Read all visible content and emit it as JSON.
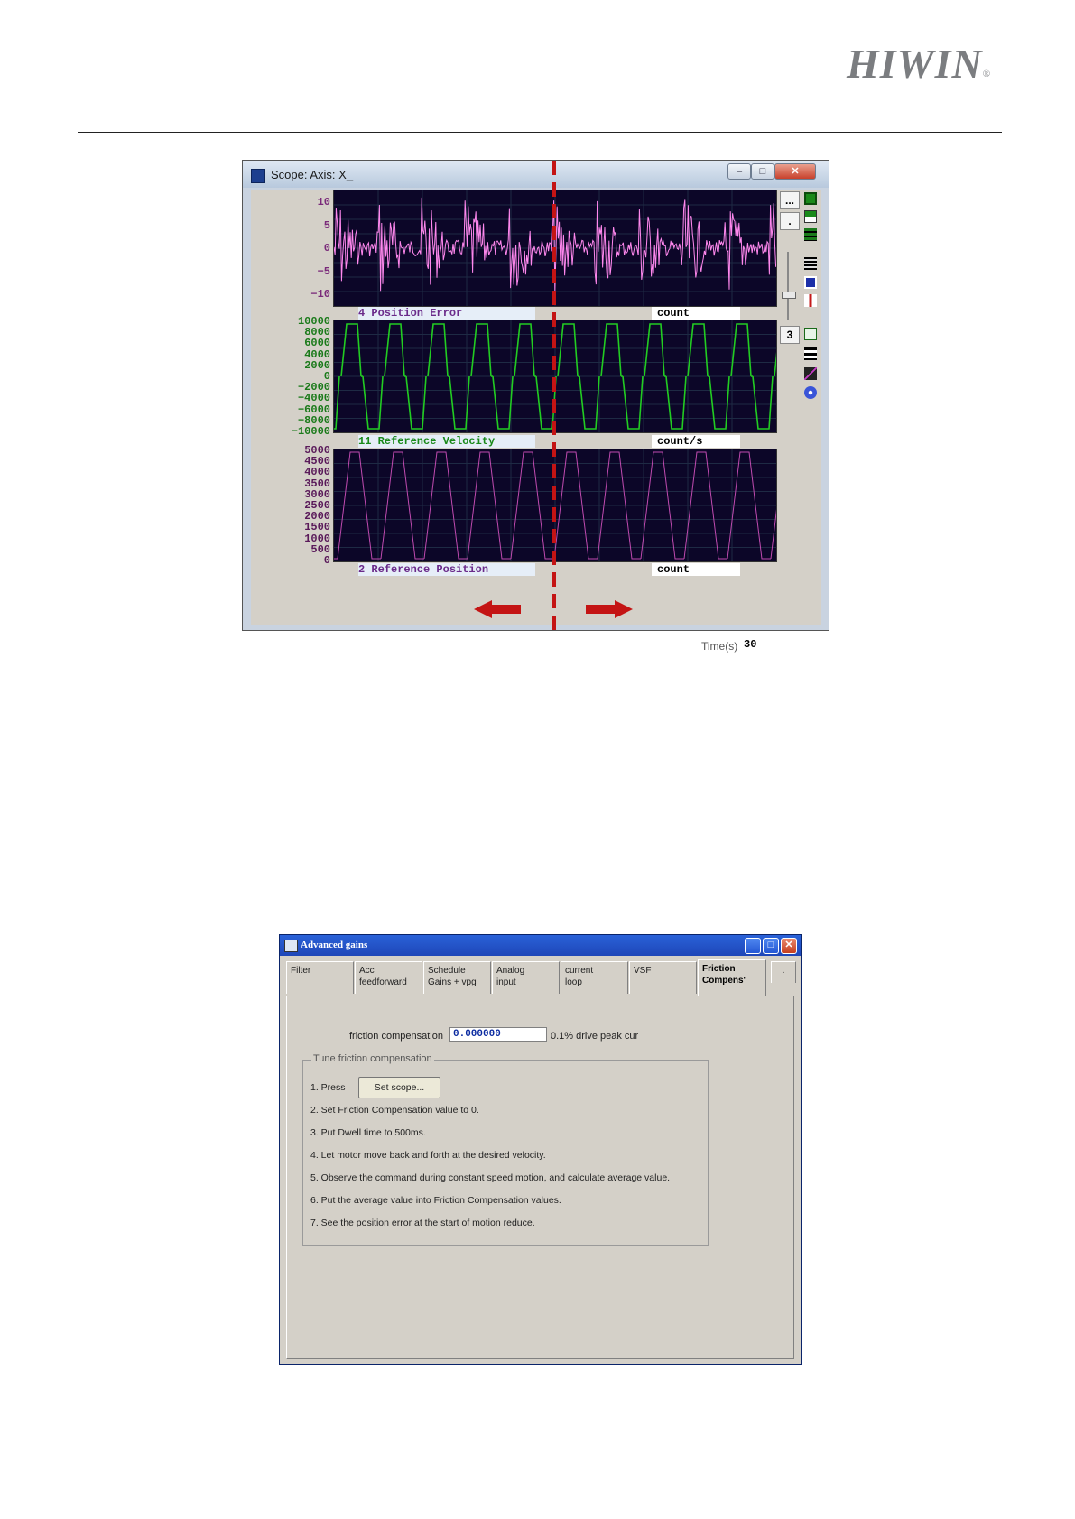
{
  "header": {
    "brand": "HIWIN",
    "brand_mark": "®"
  },
  "scope_window": {
    "title": "Scope: Axis: X_",
    "window_controls": {
      "minimize": "–",
      "maximize": "□",
      "close": "✕"
    },
    "side_buttons": {
      "more": "...",
      "dot": ".",
      "channel_number": "3"
    },
    "channels": [
      {
        "label": "4 Position Error",
        "unit": "count",
        "color": "#ff88ee",
        "y_ticks": [
          "10",
          "5",
          "0",
          "-5",
          "-10"
        ],
        "ylim": [
          -10,
          10
        ]
      },
      {
        "label": "11 Reference Velocity",
        "unit": "count/s",
        "color": "#22cc22",
        "y_ticks": [
          "10000",
          "8000",
          "6000",
          "4000",
          "2000",
          "0",
          "-2000",
          "-4000",
          "-6000",
          "-8000",
          "-10000"
        ],
        "ylim": [
          -10000,
          10000
        ]
      },
      {
        "label": "2 Reference Position",
        "unit": "count",
        "color": "#c04bb0",
        "y_ticks": [
          "5000",
          "4500",
          "4000",
          "3500",
          "3000",
          "2500",
          "2000",
          "1500",
          "1000",
          "500",
          "0"
        ],
        "ylim": [
          0,
          5000
        ]
      }
    ],
    "time_label": "Time(s)",
    "time_value": "30",
    "annotation_colors": {
      "arrow": "#cc1111",
      "divider": "#cc1111"
    }
  },
  "advanced_window": {
    "title": "Advanced gains",
    "tabs": [
      {
        "line1": "Filter",
        "line2": ""
      },
      {
        "line1": "Acc",
        "line2": "feedforward"
      },
      {
        "line1": "Schedule",
        "line2": "Gains + vpg"
      },
      {
        "line1": "Analog",
        "line2": "input"
      },
      {
        "line1": "current",
        "line2": "loop"
      },
      {
        "line1": "VSF",
        "line2": ""
      },
      {
        "line1": "Friction",
        "line2": "Compens'"
      }
    ],
    "tab_scroll": ".",
    "friction_label": "friction compensation",
    "friction_value": "0.000000",
    "friction_unit": "0.1% drive peak cur",
    "group_title": "Tune friction compensation",
    "press_label": "1. Press",
    "set_scope_button": "Set scope...",
    "steps": [
      "2. Set Friction Compensation value to 0.",
      "3. Put Dwell time to 500ms.",
      "4. Let motor move back and forth at the desired velocity.",
      "5. Observe the command during constant speed motion, and calculate average value.",
      "6. Put the average value into Friction Compensation values.",
      "7. See the position error at the start of motion reduce."
    ]
  }
}
